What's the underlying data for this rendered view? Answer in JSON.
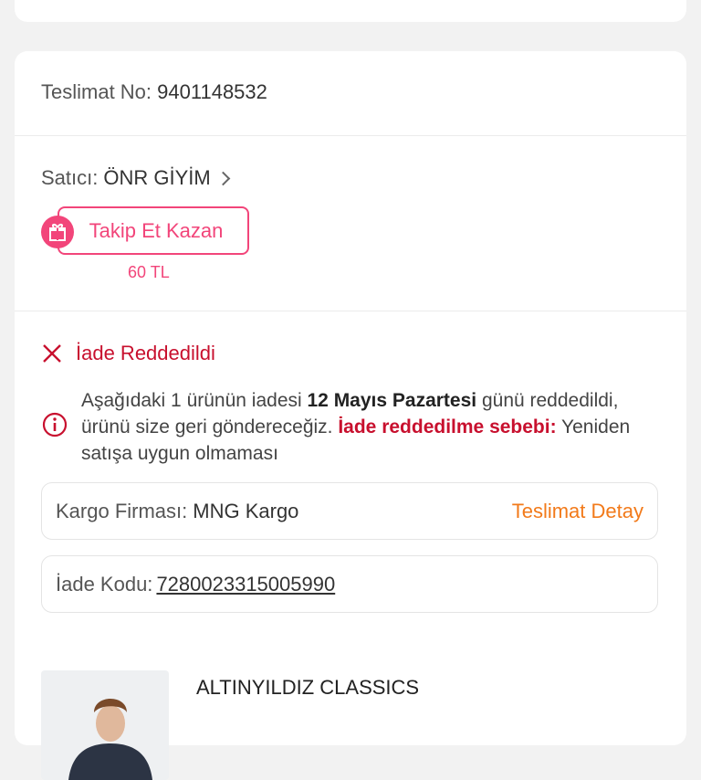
{
  "delivery": {
    "label": "Teslimat No:",
    "number": "9401148532"
  },
  "seller": {
    "label": "Satıcı:",
    "name": "ÖNR GİYİM"
  },
  "follow": {
    "button_label": "Takip Et Kazan",
    "bonus": "60 TL"
  },
  "return_status": {
    "title": "İade Reddedildi",
    "message_pre": "Aşağıdaki 1 ürünün iadesi ",
    "date": "12 Mayıs Pazartesi",
    "message_mid": " günü reddedildi, ürünü size geri göndereceğiz. ",
    "reason_label": "İade reddedilme sebebi:",
    "reason": " Yeniden satışa uygun olmaması"
  },
  "cargo": {
    "label": "Kargo Firması:",
    "company": "MNG Kargo",
    "detail_link": "Teslimat Detay"
  },
  "return_code": {
    "label": "İade Kodu:",
    "code": "7280023315005990"
  },
  "product": {
    "brand": "ALTINYILDIZ CLASSICS"
  },
  "colors": {
    "accent": "#f2457a",
    "error": "#c8102e",
    "link": "#f27a1a"
  }
}
